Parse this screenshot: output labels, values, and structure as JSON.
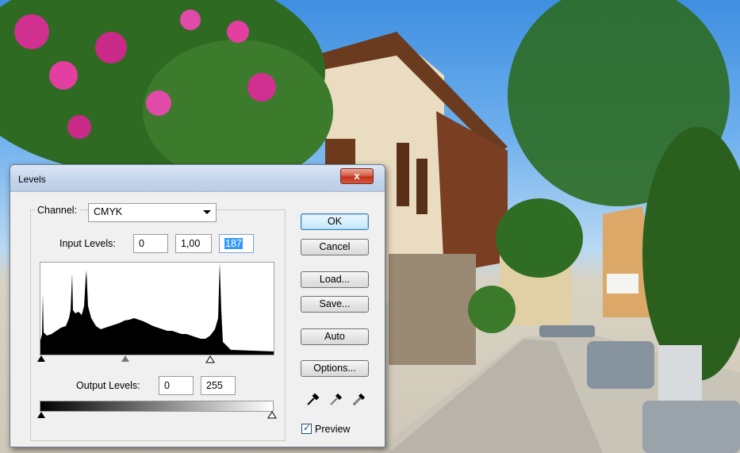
{
  "dialog": {
    "title": "Levels",
    "close_label": "x",
    "channel_label": "Channel:",
    "channel_value": "CMYK",
    "input_levels_label": "Input Levels:",
    "input_levels": [
      "0",
      "1,00",
      "187"
    ],
    "output_levels_label": "Output Levels:",
    "output_levels": [
      "0",
      "255"
    ],
    "buttons": {
      "ok": "OK",
      "cancel": "Cancel",
      "load": "Load...",
      "save": "Save...",
      "auto": "Auto",
      "options": "Options..."
    },
    "preview_label": "Preview",
    "preview_checked": true
  },
  "icons": [
    "close-icon",
    "dropdown-arrow-icon",
    "black-eyedropper-icon",
    "gray-eyedropper-icon",
    "white-eyedropper-icon"
  ],
  "colors": {
    "accent_selection": "#3399ff",
    "close_button": "#c2331b"
  }
}
